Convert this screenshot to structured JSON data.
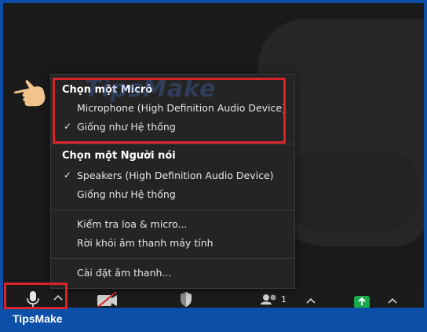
{
  "audio_menu": {
    "microphone_section": {
      "heading": "Chọn một Micrô",
      "items": [
        {
          "label": "Microphone (High Definition Audio Device)",
          "checked": false
        },
        {
          "label": "Giống như Hệ thống",
          "checked": true
        }
      ]
    },
    "speaker_section": {
      "heading": "Chọn một Người nói",
      "items": [
        {
          "label": "Speakers (High Definition Audio Device)",
          "checked": true
        },
        {
          "label": "Giống như Hệ thống",
          "checked": false
        }
      ]
    },
    "actions": [
      {
        "label": "Kiểm tra loa & micro..."
      },
      {
        "label": "Rời khỏi âm thanh máy tính"
      }
    ],
    "settings": {
      "label": "Cài đặt âm thanh..."
    },
    "check_mark": "✓"
  },
  "watermark": {
    "text": "TipsMake"
  },
  "toolbar": {
    "participants_count": "1"
  },
  "footer": {
    "brand": "TipsMake"
  },
  "colors": {
    "highlight": "#d8232a",
    "footer_bg": "#0b4fa8",
    "menu_bg": "#242424",
    "share_green": "#19a94b"
  },
  "icons": [
    "pointing-hand-icon",
    "microphone-icon",
    "chevron-up-icon",
    "video-off-icon",
    "security-shield-icon",
    "participants-icon",
    "share-screen-icon"
  ]
}
